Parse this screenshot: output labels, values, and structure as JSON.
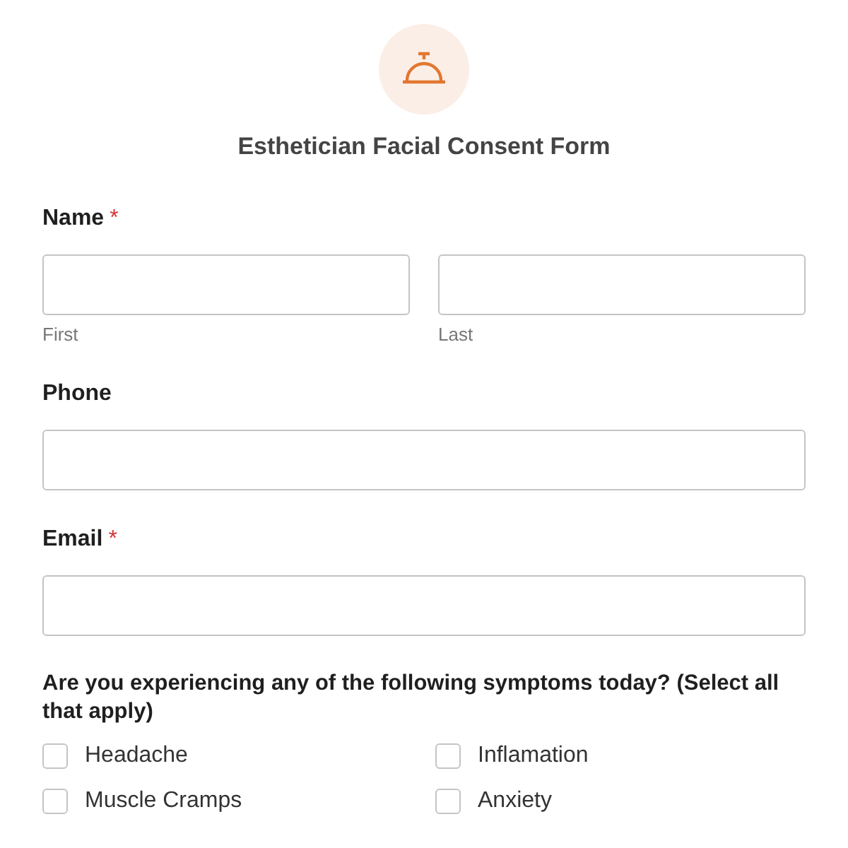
{
  "form": {
    "title": "Esthetician Facial Consent Form"
  },
  "fields": [
    {
      "kind": "name",
      "label": "Name",
      "required_mark": "*",
      "parts": [
        {
          "sublabel": "First"
        },
        {
          "sublabel": "Last"
        }
      ]
    },
    {
      "kind": "text",
      "label": "Phone"
    },
    {
      "kind": "text",
      "label": "Email",
      "required_mark": "*"
    }
  ],
  "question": {
    "label": "Are you experiencing any of the following symptoms today? (Select all that apply)",
    "options": [
      {
        "label": "Headache",
        "checked": false
      },
      {
        "label": "Inflamation",
        "checked": false
      },
      {
        "label": "Muscle Cramps",
        "checked": false
      },
      {
        "label": "Anxiety",
        "checked": false
      }
    ]
  }
}
